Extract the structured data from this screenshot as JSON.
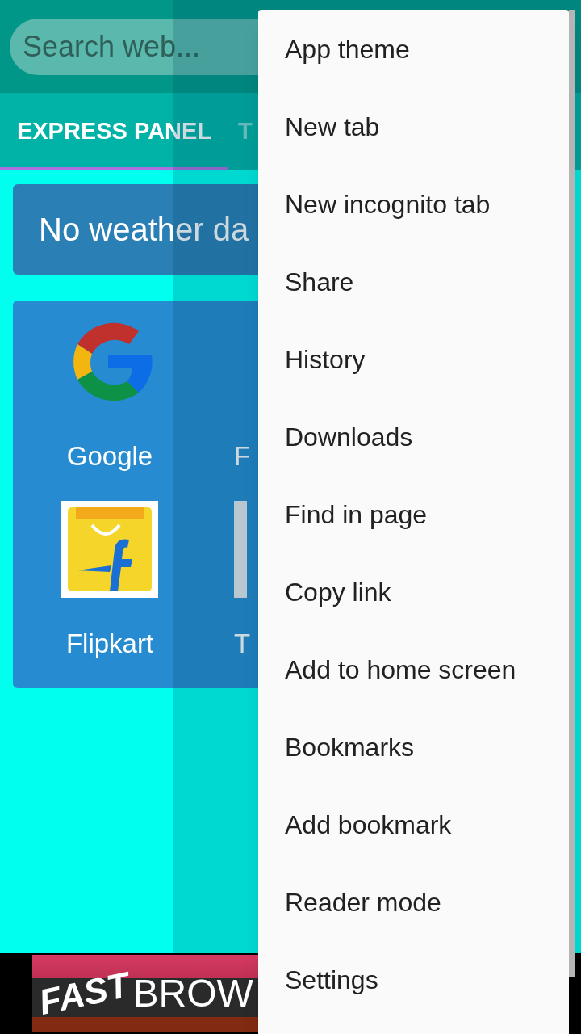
{
  "search": {
    "placeholder": "Search web..."
  },
  "tabs": [
    {
      "label": "EXPRESS PANEL",
      "selected": true
    },
    {
      "label": "T",
      "selected": false
    }
  ],
  "weather": {
    "message": "No weather da"
  },
  "speed_dial": [
    {
      "label": "Google",
      "kind": "google"
    },
    {
      "label": "F",
      "kind": "hidden"
    },
    {
      "label": "Flipkart",
      "kind": "flipkart"
    },
    {
      "label": "T",
      "kind": "partial"
    }
  ],
  "banner": {
    "words": [
      "FAST",
      "BROW"
    ]
  },
  "menu": [
    "App theme",
    "New tab",
    "New incognito tab",
    "Share",
    "History",
    "Downloads",
    "Find in page",
    "Copy link",
    "Add to home screen",
    "Bookmarks",
    "Add bookmark",
    "Reader mode",
    "Settings"
  ]
}
